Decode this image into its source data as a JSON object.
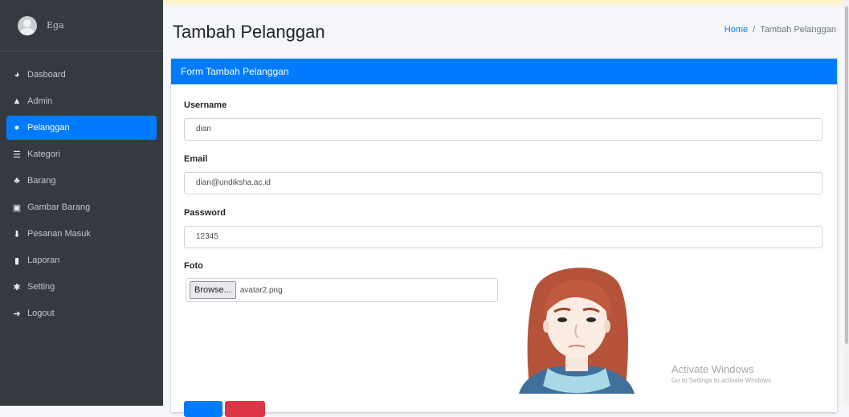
{
  "sidebar": {
    "user_name": "Ega",
    "items": [
      {
        "label": "Dasboard",
        "icon": "tachometer-icon",
        "glyph": "◕",
        "active": false
      },
      {
        "label": "Admin",
        "icon": "user-icon",
        "glyph": "▲",
        "active": false
      },
      {
        "label": "Pelanggan",
        "icon": "users-icon",
        "glyph": "●",
        "active": true
      },
      {
        "label": "Kategori",
        "icon": "list-icon",
        "glyph": "☰",
        "active": false
      },
      {
        "label": "Barang",
        "icon": "cubes-icon",
        "glyph": "♣",
        "active": false
      },
      {
        "label": "Gambar Barang",
        "icon": "image-icon",
        "glyph": "▣",
        "active": false
      },
      {
        "label": "Pesanan Masuk",
        "icon": "download-icon",
        "glyph": "⬇",
        "active": false
      },
      {
        "label": "Laporan",
        "icon": "file-icon",
        "glyph": "▮",
        "active": false
      },
      {
        "label": "Setting",
        "icon": "gear-icon",
        "glyph": "✱",
        "active": false
      },
      {
        "label": "Logout",
        "icon": "sign-out-icon",
        "glyph": "➜",
        "active": false
      }
    ]
  },
  "header": {
    "title": "Tambah Pelanggan",
    "breadcrumb_home": "Home",
    "breadcrumb_separator": "/",
    "breadcrumb_current": "Tambah Pelanggan"
  },
  "form": {
    "card_title": "Form Tambah Pelanggan",
    "username_label": "Username",
    "username_value": "dian",
    "email_label": "Email",
    "email_value": "dian@undiksha.ac.id",
    "password_label": "Password",
    "password_value": "12345",
    "foto_label": "Foto",
    "browse_label": "Browse...",
    "file_name": "avatar2.png"
  },
  "watermark": {
    "line1": "Activate Windows",
    "line2": "Go to Settings to activate Windows."
  },
  "colors": {
    "primary": "#007bff",
    "danger": "#dc3545",
    "sidebar_bg": "#343a40"
  }
}
